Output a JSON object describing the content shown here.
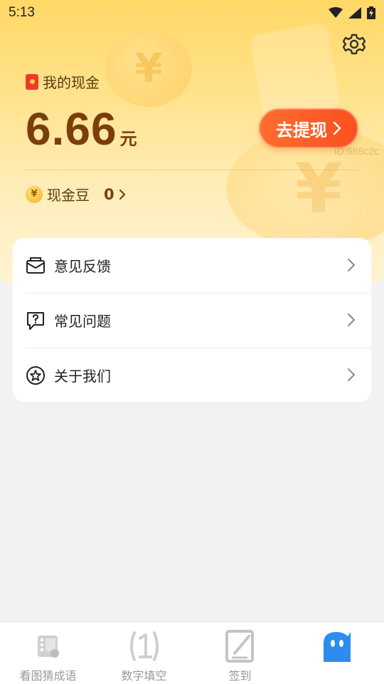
{
  "status_bar": {
    "time": "5:13"
  },
  "header": {
    "cash_label": "我的现金",
    "amount": "6.66",
    "amount_unit": "元",
    "withdraw_label": "去提现",
    "watermark": "ID:688c2c",
    "bean_label": "现金豆",
    "bean_count": "0"
  },
  "menu": {
    "items": [
      {
        "label": "意见反馈",
        "icon": "feedback-mail-icon"
      },
      {
        "label": "常见问题",
        "icon": "question-bubble-icon"
      },
      {
        "label": "关于我们",
        "icon": "star-circle-icon"
      }
    ]
  },
  "bottom_nav": {
    "items": [
      {
        "label": "看图猜成语",
        "icon": "film-icon"
      },
      {
        "label": "数字填空",
        "icon": "number-one-icon"
      },
      {
        "label": "签到",
        "icon": "edit-note-icon"
      },
      {
        "label": "",
        "icon": "ghost-mascot-icon"
      }
    ]
  },
  "colors": {
    "accent_orange": "#f9501f",
    "amount_brown": "#7a3e0c",
    "mascot_blue": "#2d8cf0"
  }
}
